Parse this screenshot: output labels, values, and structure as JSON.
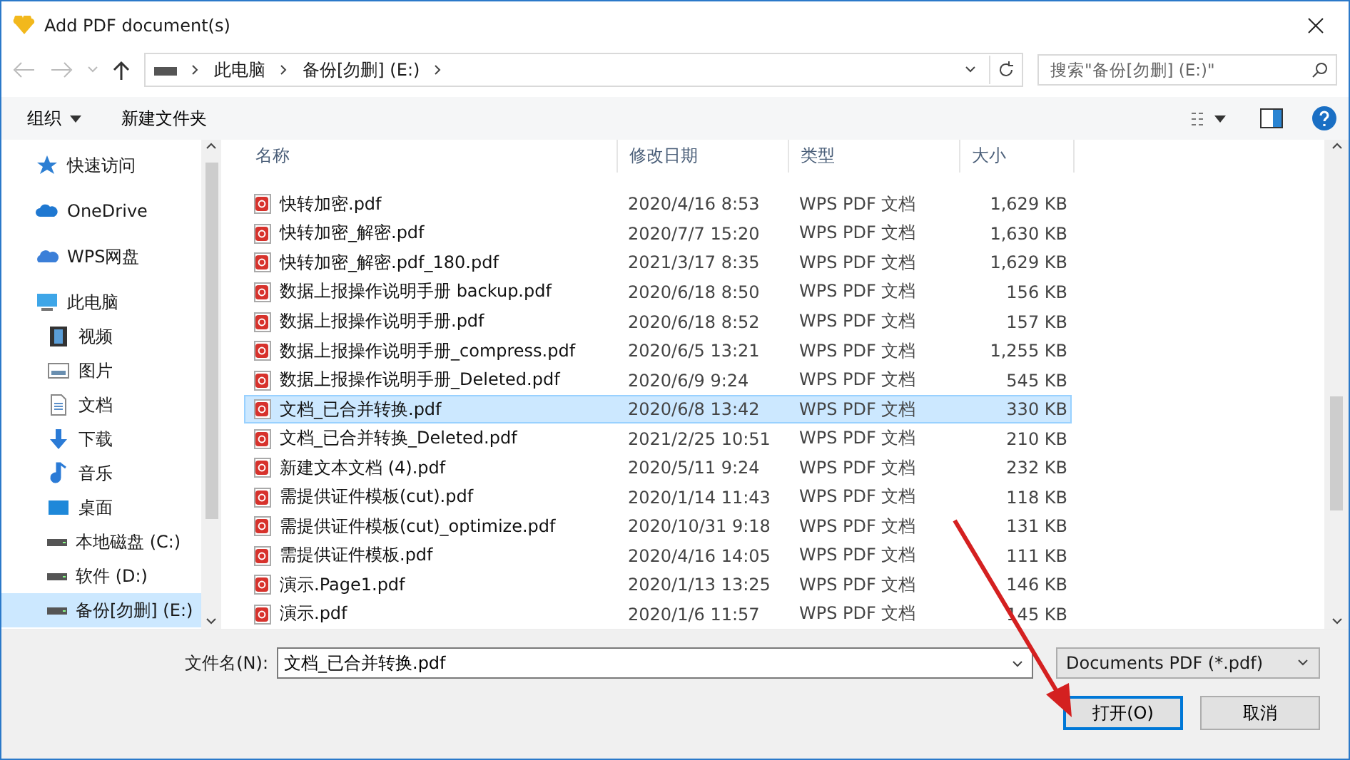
{
  "window": {
    "title": "Add PDF document(s)"
  },
  "address": {
    "crumbs": [
      "此电脑",
      "备份[勿删] (E:)"
    ]
  },
  "search": {
    "placeholder": "搜索\"备份[勿删] (E:)\""
  },
  "toolbar": {
    "organize": "组织",
    "new_folder": "新建文件夹"
  },
  "sidebar": {
    "items": [
      {
        "label": "快速访问",
        "kind": "star",
        "selected": false
      },
      {
        "label": "OneDrive",
        "kind": "cloud",
        "selected": false
      },
      {
        "label": "WPS网盘",
        "kind": "wpscloud",
        "selected": false
      },
      {
        "label": "此电脑",
        "kind": "pc",
        "selected": false,
        "children": [
          {
            "label": "视频",
            "kind": "video",
            "selected": false
          },
          {
            "label": "图片",
            "kind": "picture",
            "selected": false
          },
          {
            "label": "文档",
            "kind": "doc",
            "selected": false
          },
          {
            "label": "下载",
            "kind": "download",
            "selected": false
          },
          {
            "label": "音乐",
            "kind": "music",
            "selected": false
          },
          {
            "label": "桌面",
            "kind": "desktop",
            "selected": false
          },
          {
            "label": "本地磁盘 (C:)",
            "kind": "drive",
            "selected": false
          },
          {
            "label": "软件 (D:)",
            "kind": "drive",
            "selected": false
          },
          {
            "label": "备份[勿删] (E:)",
            "kind": "drive",
            "selected": true
          }
        ]
      }
    ]
  },
  "table": {
    "columns": [
      "名称",
      "修改日期",
      "类型",
      "大小"
    ],
    "rows": [
      {
        "name": "快转加密.pdf",
        "date": "2020/4/16 8:53",
        "type": "WPS PDF 文档",
        "size": "1,629 KB",
        "selected": false
      },
      {
        "name": "快转加密_解密.pdf",
        "date": "2020/7/7 15:20",
        "type": "WPS PDF 文档",
        "size": "1,630 KB",
        "selected": false
      },
      {
        "name": "快转加密_解密.pdf_180.pdf",
        "date": "2021/3/17 8:35",
        "type": "WPS PDF 文档",
        "size": "1,629 KB",
        "selected": false
      },
      {
        "name": "数据上报操作说明手册 backup.pdf",
        "date": "2020/6/18 8:50",
        "type": "WPS PDF 文档",
        "size": "156 KB",
        "selected": false
      },
      {
        "name": "数据上报操作说明手册.pdf",
        "date": "2020/6/18 8:52",
        "type": "WPS PDF 文档",
        "size": "157 KB",
        "selected": false
      },
      {
        "name": "数据上报操作说明手册_compress.pdf",
        "date": "2020/6/5 13:21",
        "type": "WPS PDF 文档",
        "size": "1,255 KB",
        "selected": false
      },
      {
        "name": "数据上报操作说明手册_Deleted.pdf",
        "date": "2020/6/9 9:24",
        "type": "WPS PDF 文档",
        "size": "545 KB",
        "selected": false
      },
      {
        "name": "文档_已合并转换.pdf",
        "date": "2020/6/8 13:42",
        "type": "WPS PDF 文档",
        "size": "330 KB",
        "selected": true
      },
      {
        "name": "文档_已合并转换_Deleted.pdf",
        "date": "2021/2/25 10:51",
        "type": "WPS PDF 文档",
        "size": "210 KB",
        "selected": false
      },
      {
        "name": "新建文本文档 (4).pdf",
        "date": "2020/5/11 9:24",
        "type": "WPS PDF 文档",
        "size": "232 KB",
        "selected": false
      },
      {
        "name": "需提供证件模板(cut).pdf",
        "date": "2020/1/14 11:43",
        "type": "WPS PDF 文档",
        "size": "118 KB",
        "selected": false
      },
      {
        "name": "需提供证件模板(cut)_optimize.pdf",
        "date": "2020/10/31 9:18",
        "type": "WPS PDF 文档",
        "size": "131 KB",
        "selected": false
      },
      {
        "name": "需提供证件模板.pdf",
        "date": "2020/4/16 14:05",
        "type": "WPS PDF 文档",
        "size": "111 KB",
        "selected": false
      },
      {
        "name": "演示.Page1.pdf",
        "date": "2020/1/13 13:25",
        "type": "WPS PDF 文档",
        "size": "146 KB",
        "selected": false
      },
      {
        "name": "演示.pdf",
        "date": "2020/1/6 11:57",
        "type": "WPS PDF 文档",
        "size": "145 KB",
        "selected": false
      }
    ]
  },
  "footer": {
    "filename_label": "文件名(N):",
    "filename": "文档_已合并转换.pdf",
    "filter": "Documents PDF (*.pdf)",
    "open": "打开(O)",
    "cancel": "取消"
  }
}
